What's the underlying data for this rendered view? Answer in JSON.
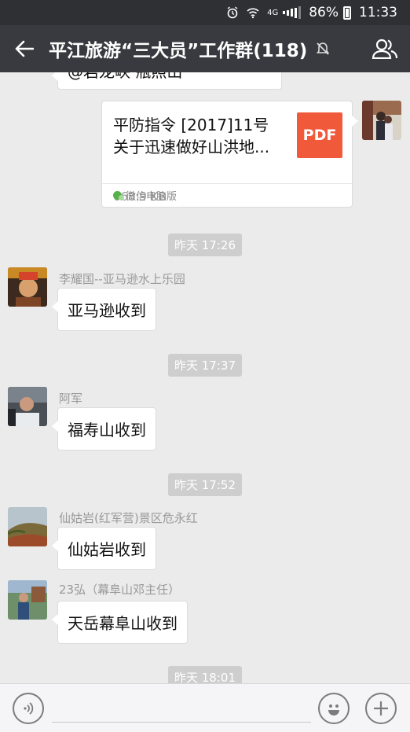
{
  "status_bar": {
    "network": "4G",
    "battery": "86%",
    "time": "11:33"
  },
  "header": {
    "title": "平江旅游“三大员”工作群(118)"
  },
  "top_partial": {
    "text": "@岩龙峡  瓶照山"
  },
  "file_message": {
    "title_line1": "平防指令 [2017]11号",
    "title_line2": "关于迅速做好山洪地...",
    "size": "668.9 KB",
    "file_type": "PDF",
    "source": "微信电脑版"
  },
  "messages": [
    {
      "time": "昨天 17:26",
      "sender": "李耀国--亚马逊水上乐园",
      "text": "亚马逊收到"
    },
    {
      "time": "昨天 17:37",
      "sender": "阿军",
      "text": "福寿山收到"
    },
    {
      "time": "昨天 17:52",
      "sender": "仙姑岩(红军营)景区危永红",
      "text": "仙姑岩收到"
    },
    {
      "time": "",
      "sender": "23弘（幕阜山邓主任）",
      "text": "天岳幕阜山收到"
    }
  ],
  "last_time": "昨天 18:01",
  "colors": {
    "title_bar": "#393a3f",
    "status_bar": "#2e3033",
    "chat_bg": "#ebebeb",
    "pdf_red": "#f05a3a"
  }
}
